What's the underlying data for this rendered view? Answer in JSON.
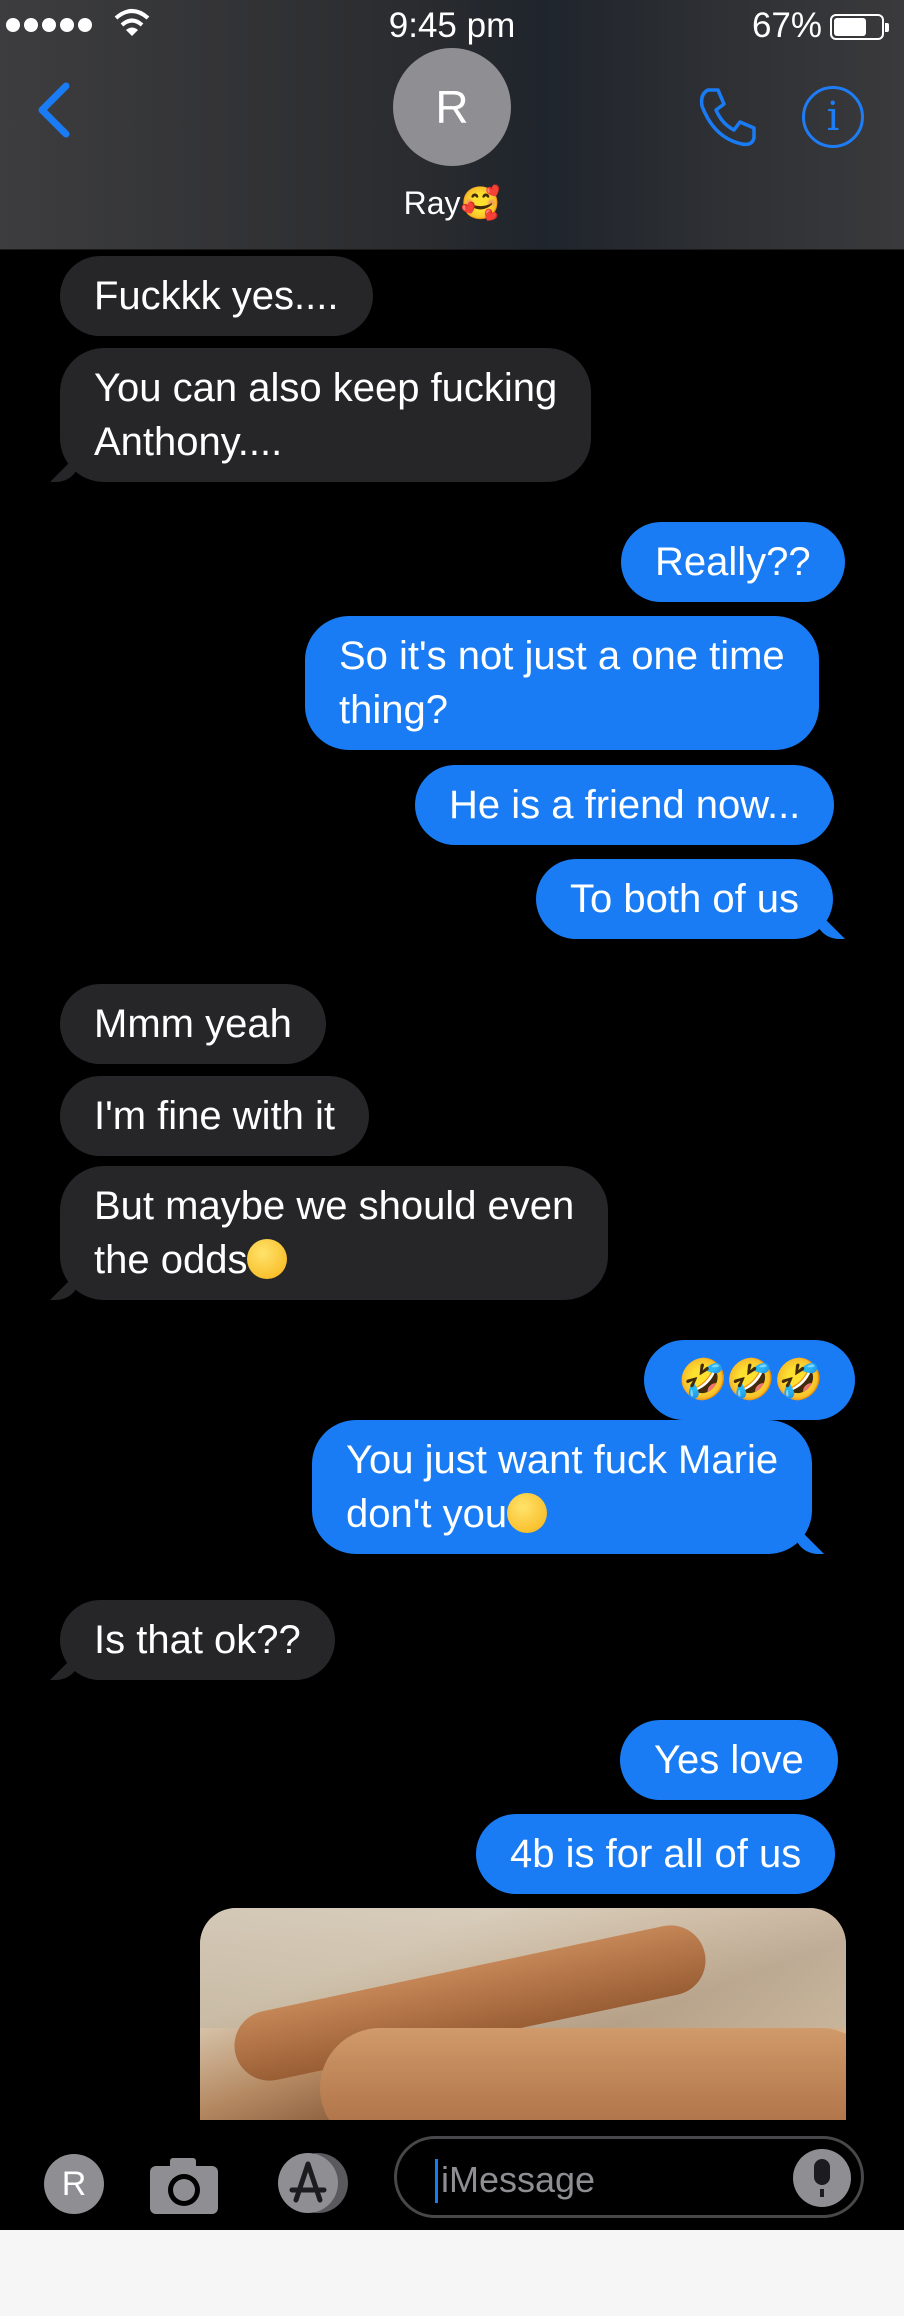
{
  "status_bar": {
    "time": "9:45 pm",
    "battery": "67%"
  },
  "header": {
    "avatar_initial": "R",
    "contact_name": "Ray🥰"
  },
  "messages": [
    {
      "from": "them",
      "text": "Fuckkk yes...."
    },
    {
      "from": "them",
      "lines": [
        "You can also keep fucking",
        "Anthony...."
      ]
    },
    {
      "from": "me",
      "text": "Really??"
    },
    {
      "from": "me",
      "lines": [
        "So it's not just a one time",
        "thing?"
      ]
    },
    {
      "from": "me",
      "text": "He is a friend now..."
    },
    {
      "from": "me",
      "text": "To both of us"
    },
    {
      "from": "them",
      "text": "Mmm yeah"
    },
    {
      "from": "them",
      "text": "I'm fine with it"
    },
    {
      "from": "them",
      "lines": [
        "But maybe we should even",
        "the odds"
      ],
      "emoji": "wink"
    },
    {
      "from": "me",
      "emoji_only": "🤣🤣🤣"
    },
    {
      "from": "me",
      "lines": [
        "You just want fuck Marie",
        "don't you"
      ],
      "emoji": "wink"
    },
    {
      "from": "them",
      "text": "Is that ok??"
    },
    {
      "from": "me",
      "text": "Yes love"
    },
    {
      "from": "me",
      "text": "4b is for all of us"
    }
  ],
  "composer": {
    "avatar_initial": "R",
    "placeholder": "iMessage"
  },
  "icons": {
    "back": "chevron-left-icon",
    "phone": "phone-icon",
    "info": "info-icon",
    "camera": "camera-icon",
    "apps": "app-store-icon",
    "mic": "microphone-icon"
  },
  "colors": {
    "accent": "#1a7cf5",
    "incoming": "#262628",
    "background": "#000000"
  }
}
